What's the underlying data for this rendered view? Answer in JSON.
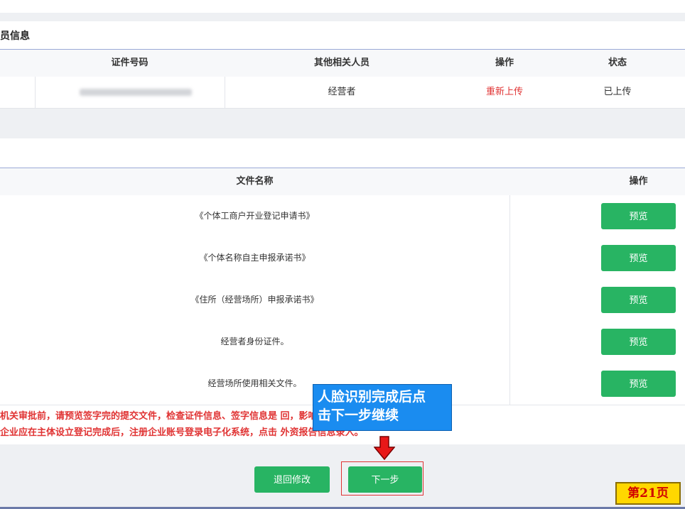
{
  "section1": {
    "title": "员信息",
    "headers": {
      "id_number": "证件号码",
      "related": "其他相关人员",
      "action": "操作",
      "status": "状态"
    },
    "row": {
      "related": "经营者",
      "action": "重新上传",
      "status": "已上传"
    }
  },
  "section2": {
    "headers": {
      "file_name": "文件名称",
      "action": "操作"
    },
    "files": [
      {
        "name": "《个体工商户开业登记申请书》",
        "action": "预览"
      },
      {
        "name": "《个体名称自主申报承诺书》",
        "action": "预览"
      },
      {
        "name": "《住所（经营场所）申报承诺书》",
        "action": "预览"
      },
      {
        "name": "经营者身份证件。",
        "action": "预览"
      },
      {
        "name": "经营场所使用相关文件。",
        "action": "预览"
      }
    ]
  },
  "notice": {
    "line1": "机关审批前，请预览签字完的提交文件，检查证件信息、签字信息是                                    回，影响办理进度。",
    "line2": "企业应在主体设立登记完成后，注册企业账号登录电子化系统，点击                                    外资报告信息录入。"
  },
  "callout": {
    "line1": "人脸识别完成后点",
    "line2": "击下一步继续"
  },
  "buttons": {
    "back": "退回修改",
    "next": "下一步"
  },
  "page_badge": "第21页",
  "colors": {
    "green": "#28b463",
    "red": "#e03333",
    "callout_blue": "#1a8cf0",
    "badge_yellow": "#ffd700"
  }
}
